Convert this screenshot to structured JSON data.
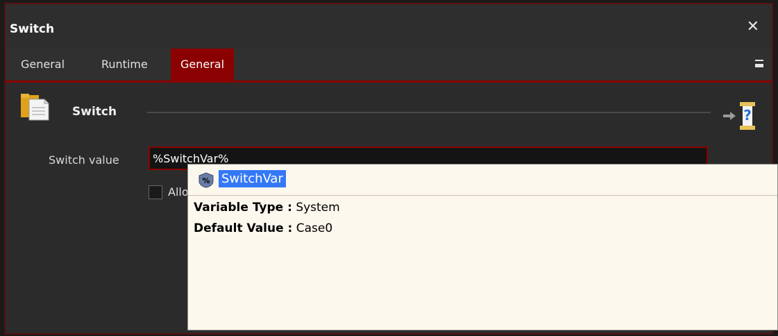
{
  "window": {
    "title": "Switch",
    "close_glyph": "✕"
  },
  "tabs": [
    {
      "label": "General",
      "active": false
    },
    {
      "label": "Runtime",
      "active": false
    },
    {
      "label": "General",
      "active": true
    }
  ],
  "section": {
    "icon": "folder-icon",
    "title": "Switch",
    "help_icon": "help-icon"
  },
  "form": {
    "switch_value_label": "Switch value",
    "switch_value": "%SwitchVar%",
    "checkbox_label_partial": "Allo",
    "checkbox_checked": false
  },
  "autocomplete": {
    "icon": "variable-icon",
    "icon_glyph": "%",
    "variable_name": "SwitchVar",
    "variable_type_label": "Variable Type :",
    "variable_type_value": "System",
    "default_value_label": "Default Value :",
    "default_value_value": "Case0"
  },
  "colors": {
    "accent": "#8b0000",
    "selection": "#3478f6",
    "popup_bg": "#fdf8ee"
  }
}
